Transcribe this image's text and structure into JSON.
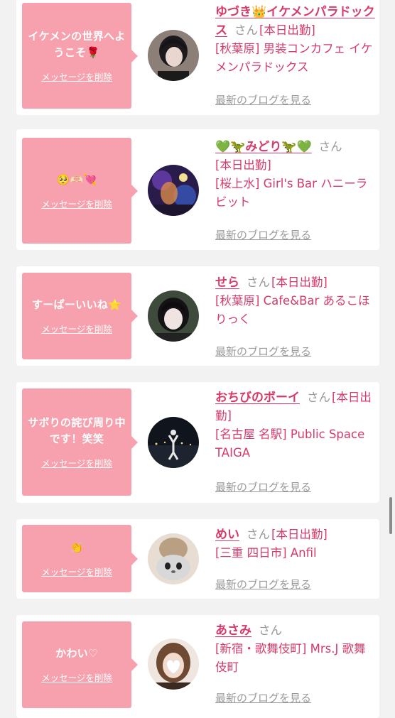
{
  "delete_label": "メッセージを削除",
  "blog_label": "最新のブログを見る",
  "honorific": "さん",
  "entries": [
    {
      "message": "イケメンの世界へようこそ🌹",
      "name": "ゆづき👑イケメンパラドックス",
      "status": "[本日出勤]",
      "shop": "[秋葉原] 男装コンカフェ イケメンパラドックス"
    },
    {
      "message": "🥺🫶🏻💘",
      "name": "💚🦖みどり🦖💚",
      "status": "[本日出勤]",
      "shop": "[桜上水] Girl's Bar ハニーラビット"
    },
    {
      "message": "すーぱーいいね⭐️",
      "name": "せら",
      "status": "[本日出勤]",
      "shop": "[秋葉原] Cafe&Bar あるこほりっく"
    },
    {
      "message": "サボりの詫び周り中です！笑笑",
      "name": "おちびのボーイ",
      "status": "[本日出勤]",
      "shop": "[名古屋 名駅] Public Space TAIGA"
    },
    {
      "message": "👏",
      "name": "めい",
      "status": "[本日出勤]",
      "shop": "[三重 四日市] Anfil"
    },
    {
      "message": "かわい♡",
      "name": "あさみ",
      "status": "",
      "shop": "[新宿・歌舞伎町] Mrs.J 歌舞伎町"
    }
  ]
}
